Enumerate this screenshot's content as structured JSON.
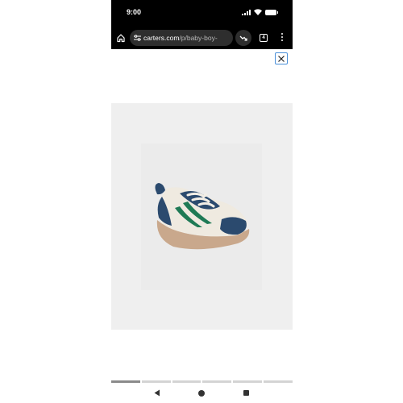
{
  "status_bar": {
    "time": "9:00",
    "icons": [
      "signal-icon",
      "wifi-icon",
      "battery-icon"
    ]
  },
  "browser": {
    "url_domain": "carters.com",
    "url_path": "/p/baby-boy-",
    "tab_count": "4",
    "icons": [
      "home-icon",
      "site-settings-icon",
      "trending-icon",
      "tabs-icon",
      "more-vert-icon"
    ]
  },
  "viewer": {
    "close_icon": "close-icon",
    "accent": "#4a8fd8",
    "image_alt": "baby sneaker"
  },
  "carousel": {
    "count": 6,
    "active_index": 0
  },
  "nav": {
    "icons": [
      "back-icon",
      "home-icon",
      "recents-icon"
    ]
  }
}
